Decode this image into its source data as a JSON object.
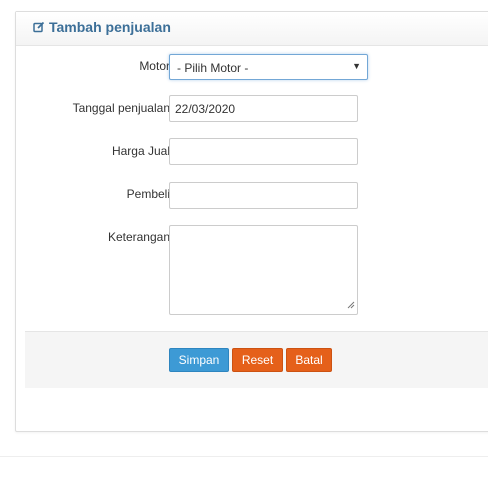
{
  "panel": {
    "title": "Tambah penjualan",
    "icon": "edit-icon"
  },
  "form": {
    "motor": {
      "label": "Motor",
      "selected": "- Pilih Motor -"
    },
    "tanggal": {
      "label": "Tanggal penjualan",
      "value": "22/03/2020"
    },
    "harga": {
      "label": "Harga Jual",
      "value": ""
    },
    "pembeli": {
      "label": "Pembeli",
      "value": ""
    },
    "keterangan": {
      "label": "Keterangan",
      "value": ""
    }
  },
  "actions": {
    "simpan": "Simpan",
    "reset": "Reset",
    "batal": "Batal"
  },
  "colors": {
    "title": "#3c6f98",
    "simpan": "#3d9ad5",
    "reset": "#e5601a",
    "batal": "#e5601a"
  }
}
